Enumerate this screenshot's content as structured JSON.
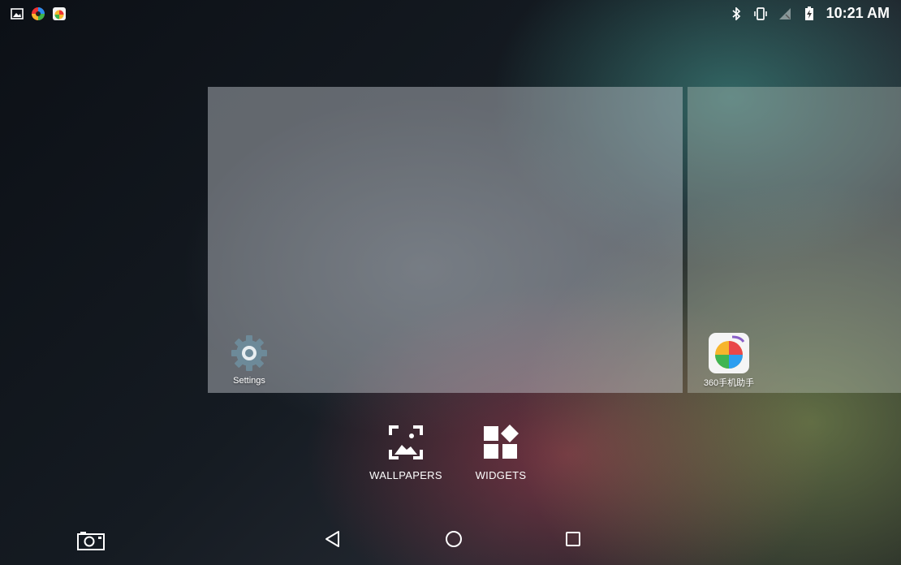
{
  "status_bar": {
    "left_icons": [
      "image-notification-icon",
      "colorful-app-notification-icon",
      "360-app-notification-icon"
    ],
    "right_icons": [
      "bluetooth-icon",
      "vibrate-icon",
      "no-signal-icon",
      "battery-charging-icon"
    ],
    "time": "10:21 AM"
  },
  "home_panels": [
    {
      "app_label": "Settings",
      "icon": "settings-gear-icon"
    },
    {
      "app_label": "360手机助手",
      "icon": "360-assistant-app-icon"
    }
  ],
  "overview_options": {
    "wallpapers_label": "WALLPAPERS",
    "widgets_label": "WIDGETS"
  },
  "navigation": {
    "left_icon": "screenshot-camera-icon",
    "back_icon": "back-icon",
    "home_icon": "home-icon",
    "recents_icon": "recents-icon"
  },
  "colors": {
    "panel_overlay": "#c8cdd2",
    "icon_white": "#ffffff"
  }
}
